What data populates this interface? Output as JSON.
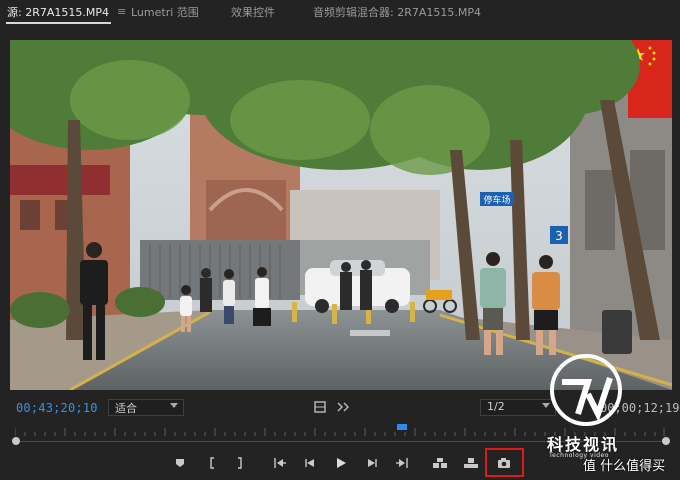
{
  "tabs": [
    {
      "label": "源: 2R7A1515.MP4",
      "active": true
    },
    {
      "label": "Lumetri 范围",
      "active": false
    },
    {
      "label": "效果控件",
      "active": false
    },
    {
      "label": "音频剪辑混合器: 2R7A1515.MP4",
      "active": false
    }
  ],
  "monitor": {
    "timecode_in": "00;43;20;10",
    "fit_select": "适合",
    "resolution_select": "1/2",
    "timecode_duration": "00;00;12;19"
  },
  "video": {
    "street_signs": [
      "停车场",
      "3"
    ]
  },
  "transport_icons": [
    "add-marker-icon",
    "mark-in-icon",
    "mark-out-icon",
    "go-to-in-icon",
    "step-back-icon",
    "play-icon",
    "step-forward-icon",
    "go-to-out-icon",
    "insert-icon",
    "overwrite-icon",
    "export-frame-icon"
  ],
  "watermark": {
    "title": "科技视讯",
    "subtitle": "Technology video",
    "site": "值 什么值得买"
  },
  "colors": {
    "timecode_blue": "#3d8fdd",
    "playhead_blue": "#2d8ceb",
    "highlight_red": "#e01a1a"
  }
}
